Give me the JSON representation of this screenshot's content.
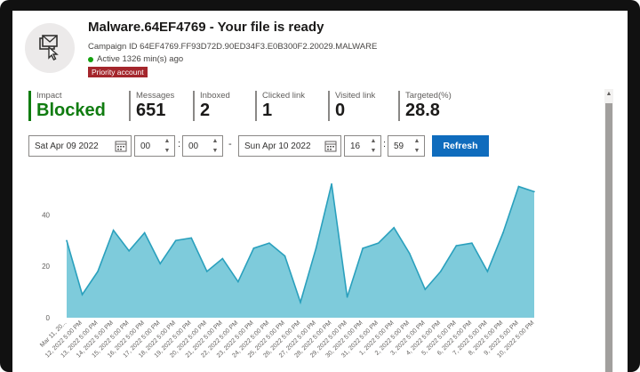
{
  "header": {
    "title": "Malware.64EF4769 - Your file is ready",
    "campaign_id": "Campaign ID 64EF4769.FF93D72D.90ED34F3.E0B300F2.20029.MALWARE",
    "active": "Active 1326 min(s) ago",
    "priority_badge": "Priority account",
    "icon": "mail-pointer-icon"
  },
  "stats": [
    {
      "label": "Impact",
      "value": "Blocked"
    },
    {
      "label": "Messages",
      "value": "651"
    },
    {
      "label": "Inboxed",
      "value": "2"
    },
    {
      "label": "Clicked link",
      "value": "1"
    },
    {
      "label": "Visited link",
      "value": "0"
    },
    {
      "label": "Targeted(%)",
      "value": "28.8"
    }
  ],
  "filters": {
    "start_date": "Sat Apr 09 2022",
    "start_hour": "00",
    "start_minute": "00",
    "end_date": "Sun Apr 10 2022",
    "end_hour": "16",
    "end_minute": "59",
    "separator": "-",
    "refresh_label": "Refresh"
  },
  "colors": {
    "area_fill": "#7ecbdb",
    "area_line": "#2aa0bd",
    "accent": "#0f6cbd",
    "blocked": "#107c10",
    "priority": "#a4262c"
  },
  "chart_data": {
    "type": "area",
    "x": [
      "Mar 11, 20...",
      "12, 2022 5:00 PM",
      "13, 2022 5:00 PM",
      "14, 2022 5:00 PM",
      "15, 2022 5:00 PM",
      "16, 2022 5:00 PM",
      "17, 2022 5:00 PM",
      "18, 2022 5:00 PM",
      "19, 2022 5:00 PM",
      "20, 2022 5:00 PM",
      "21, 2022 5:00 PM",
      "22, 2022 5:00 PM",
      "23, 2022 5:00 PM",
      "24, 2022 5:00 PM",
      "25, 2022 5:00 PM",
      "26, 2022 5:00 PM",
      "27, 2022 5:00 PM",
      "28, 2022 5:00 PM",
      "29, 2022 5:00 PM",
      "30, 2022 5:00 PM",
      "31, 2022 5:00 PM",
      "1, 2022 5:00 PM",
      "2, 2022 5:00 PM",
      "3, 2022 5:00 PM",
      "4, 2022 5:00 PM",
      "5, 2022 5:00 PM",
      "6, 2022 5:00 PM",
      "7, 2022 5:00 PM",
      "8, 2022 5:00 PM",
      "9, 2022 5:00 PM",
      "10, 2022 5:00 PM"
    ],
    "values": [
      30,
      9,
      18,
      34,
      26,
      33,
      21,
      30,
      31,
      18,
      23,
      14,
      27,
      29,
      24,
      6,
      27,
      52,
      8,
      27,
      29,
      35,
      25,
      11,
      18,
      28,
      29,
      18,
      33,
      51,
      49
    ],
    "ylim": [
      0,
      55
    ],
    "yticks": [
      0,
      20,
      40
    ],
    "grid": false
  }
}
